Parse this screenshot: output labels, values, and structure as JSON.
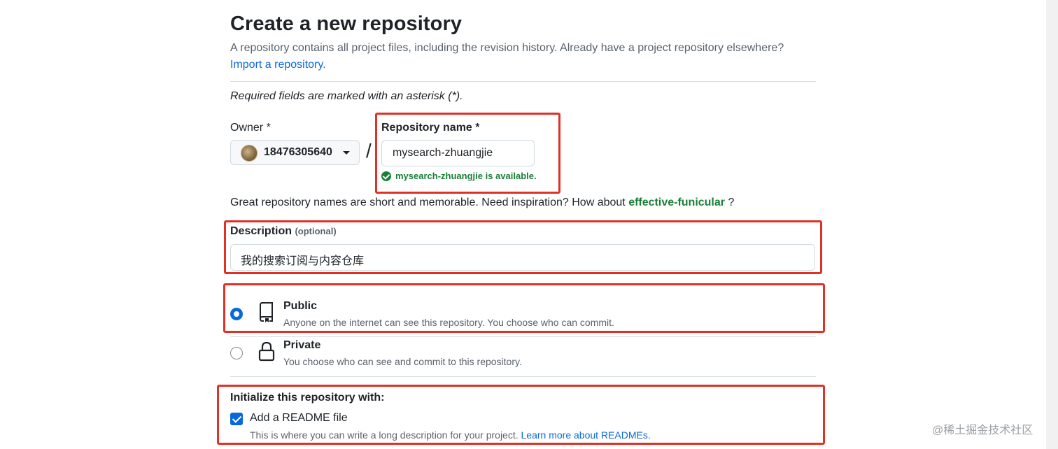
{
  "page": {
    "title": "Create a new repository",
    "subtitle": "A repository contains all project files, including the revision history. Already have a project repository elsewhere?",
    "import_link": "Import a repository.",
    "required_note": "Required fields are marked with an asterisk (*)."
  },
  "owner": {
    "label": "Owner *",
    "value": "18476305640"
  },
  "repo": {
    "separator": "/",
    "label": "Repository name *",
    "value": "mysearch-zhuangjie",
    "availability": "mysearch-zhuangjie is available."
  },
  "inspiration": {
    "text": "Great repository names are short and memorable. Need inspiration? How about",
    "suggestion": "effective-funicular",
    "suffix": "?"
  },
  "description": {
    "label": "Description",
    "optional": "(optional)",
    "value": "我的搜索订阅与内容仓库"
  },
  "visibility": {
    "selected": "public",
    "options": [
      {
        "title": "Public",
        "desc": "Anyone on the internet can see this repository. You choose who can commit.",
        "icon": "repo-icon"
      },
      {
        "title": "Private",
        "desc": "You choose who can see and commit to this repository.",
        "icon": "lock-icon"
      }
    ]
  },
  "initialize": {
    "heading": "Initialize this repository with:",
    "readme_label": "Add a README file",
    "readme_checked": true,
    "readme_desc": "This is where you can write a long description for your project.",
    "readme_link": "Learn more about READMEs."
  },
  "watermark": "@稀土掘金技术社区",
  "colors": {
    "accent": "#0969da",
    "success": "#1a7f37",
    "highlight_box": "#e03127",
    "muted_text": "#59636e"
  }
}
